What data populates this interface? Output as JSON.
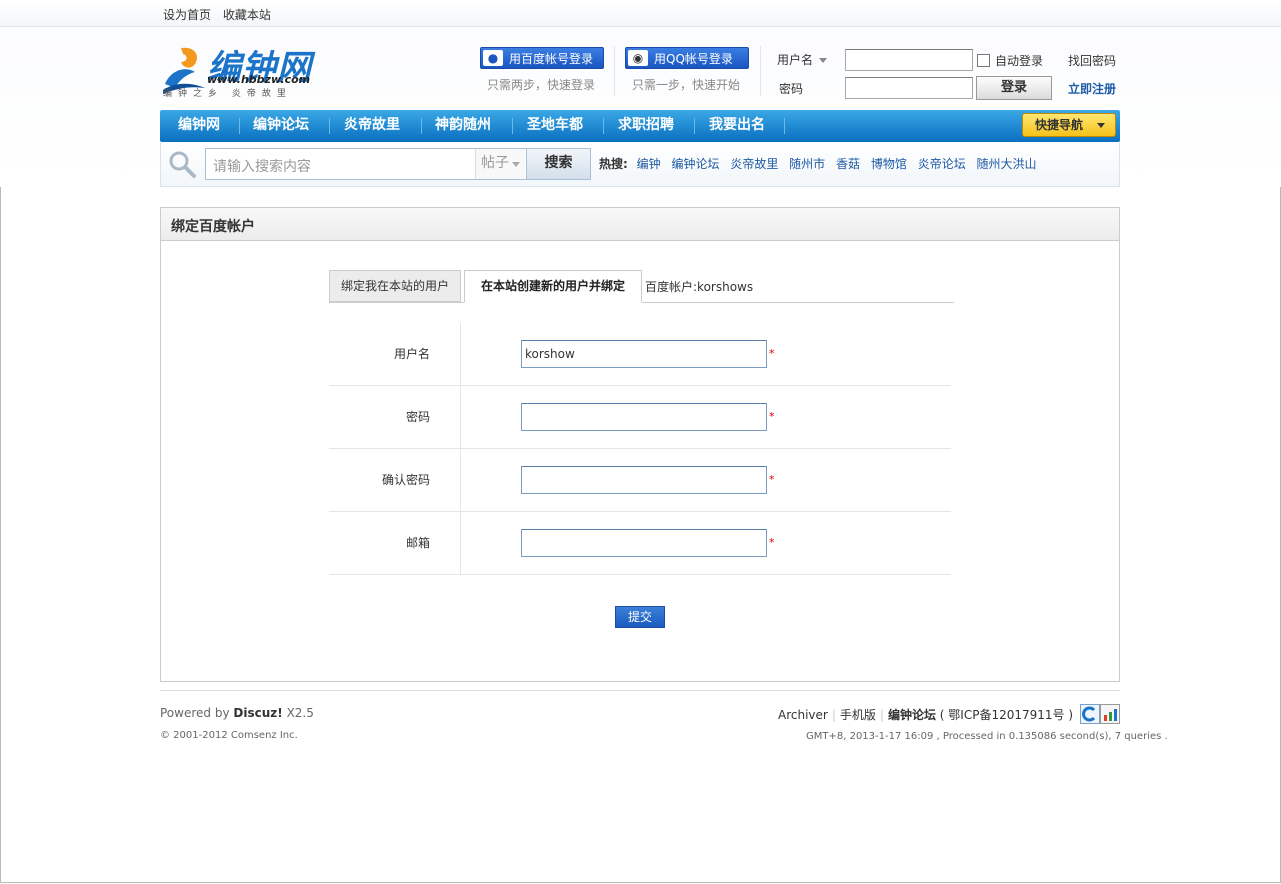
{
  "top": {
    "links": [
      "设为首页",
      "收藏本站"
    ]
  },
  "logo": {
    "name": "编钟网",
    "url": "www.hbbzw.com",
    "slogan": "编钟之乡 炎帝故里"
  },
  "login3": {
    "baidu_label": "用百度帐号登录",
    "baidu_sub": "只需两步，快速登录",
    "qq_label": "用QQ帐号登录",
    "qq_sub": "只需一步，快速开始"
  },
  "login": {
    "username_label": "用户名",
    "password_label": "密码",
    "username_value": "",
    "password_value": "",
    "autologin_label": "自动登录",
    "login_button": "登录",
    "find_password": "找回密码",
    "register": "立即注册"
  },
  "nav": {
    "items": [
      "编钟网",
      "编钟论坛",
      "炎帝故里",
      "神韵随州",
      "圣地车都",
      "求职招聘",
      "我要出名"
    ],
    "quicknav": "快捷导航"
  },
  "search": {
    "placeholder": "请输入搜索内容",
    "type": "帖子",
    "button": "搜索",
    "hot_label": "热搜:",
    "hot_terms": [
      "编钟",
      "编钟论坛",
      "炎帝故里",
      "随州市",
      "香菇",
      "博物馆",
      "炎帝论坛",
      "随州大洪山"
    ]
  },
  "panel": {
    "title": "绑定百度帐户",
    "tabs": [
      "绑定我在本站的用户",
      "在本站创建新的用户并绑定"
    ],
    "account_info": "百度帐户:korshows",
    "fields": [
      {
        "label": "用户名",
        "value": "korshow",
        "required": "*"
      },
      {
        "label": "密码",
        "value": "",
        "required": "*"
      },
      {
        "label": "确认密码",
        "value": "",
        "required": "*"
      },
      {
        "label": "邮箱",
        "value": "",
        "required": "*"
      }
    ],
    "submit": "提交"
  },
  "footer": {
    "powered_prefix": "Powered by",
    "powered_name": "Discuz!",
    "powered_version": "X2.5",
    "copyright": "© 2001-2012 Comsenz Inc.",
    "links": [
      "Archiver",
      "手机版"
    ],
    "site_name": "编钟论坛",
    "icp": "( 鄂ICP备12017911号 )",
    "processed": "GMT+8, 2013-1-17 16:09 , Processed in 0.135086 second(s), 7 queries ."
  },
  "colors": {
    "nav_blue": "#0a6fc0",
    "link_blue": "#1e5aa4",
    "required_red": "#dd0000",
    "quicknav_yellow": "#f5c21a"
  }
}
